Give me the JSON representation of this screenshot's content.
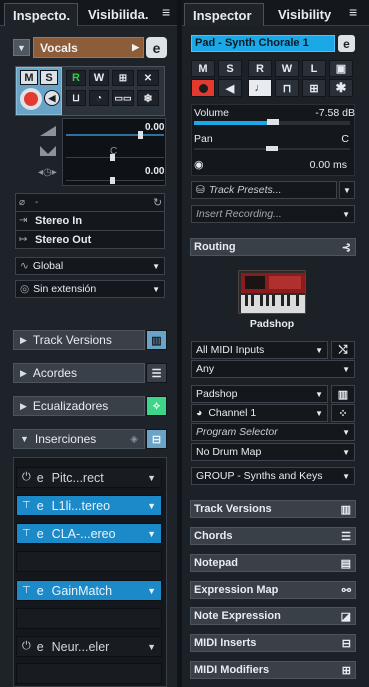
{
  "left": {
    "tabs": [
      {
        "label": "Inspecto."
      },
      {
        "label": "Visibilida."
      }
    ],
    "menu_icon": "≡",
    "track_name": "Vocals",
    "edit_icon": "e",
    "btn_m": "M",
    "btn_s": "S",
    "btn_r": "R",
    "btn_w": "W",
    "fader_top_val": "0.00",
    "fader_mid_label": "C",
    "fader_bot_val": "0.00",
    "routing": {
      "dash": "-",
      "stereo_in": "Stereo In",
      "stereo_out": "Stereo Out"
    },
    "global_select": "Global",
    "extension_select": "Sin extensión",
    "sections": {
      "track_versions": "Track Versions",
      "acordes": "Acordes",
      "ecualizadores": "Ecualizadores",
      "inserciones": "Inserciones"
    },
    "inserts": [
      {
        "name": "Pitc...rect",
        "active": false
      },
      {
        "name": "L1li...tereo",
        "active": true
      },
      {
        "name": "CLA-...ereo",
        "active": true
      },
      {
        "name": "",
        "active": false
      },
      {
        "name": "GainMatch",
        "active": true
      },
      {
        "name": "",
        "active": false
      },
      {
        "name": "Neur...eler",
        "active": false
      },
      {
        "name": "",
        "active": false
      }
    ]
  },
  "right": {
    "tabs": [
      {
        "label": "Inspector"
      },
      {
        "label": "Visibility"
      }
    ],
    "menu_icon": "≡",
    "track_name": "Pad - Synth Chorale 1",
    "edit_icon": "e",
    "buttons_row1": [
      "M",
      "S",
      "R",
      "W",
      "L"
    ],
    "volume_label": "Volume",
    "volume_value": "-7.58 dB",
    "volume_level_percent": 48,
    "pan_label": "Pan",
    "pan_value": "C",
    "delay_value": "0.00 ms",
    "track_presets": "Track Presets...",
    "insert_recording": "Insert Recording...",
    "routing_section": "Routing",
    "instrument_name": "Padshop",
    "midi_input": "All MIDI Inputs",
    "channel_any": "Any",
    "output": "Padshop",
    "channel": "Channel 1",
    "program_selector": "Program Selector",
    "drum_map": "No Drum Map",
    "group": "GROUP - Synths and Keys",
    "sections": [
      "Track Versions",
      "Chords",
      "Notepad",
      "Expression Map",
      "Note Expression",
      "MIDI Inserts",
      "MIDI Modifiers"
    ]
  }
}
